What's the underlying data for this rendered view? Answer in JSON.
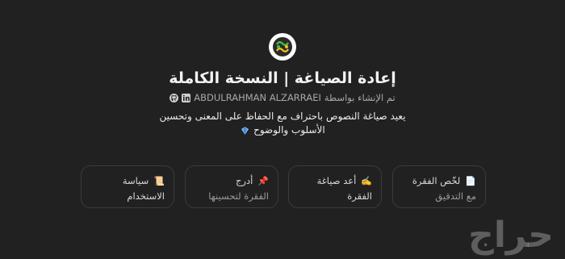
{
  "app": {
    "title": "إعادة الصياغة | النسخة الكاملة",
    "author_prefix": "تم الإنشاء بواسطة",
    "author_name": "ABDULRAHMAN ALZARRAEI",
    "description": "يعيد صياغة النصوص باحتراف مع الحفاظ على المعنى وتحسين الأسلوب والوضوح",
    "logo_icon": "rephrase-logo-icon",
    "accent_color": "#3fb24a"
  },
  "cards": [
    {
      "line1": "لخّص الفقرة",
      "line2": "مع التدقيق",
      "emoji": "📄"
    },
    {
      "line1": "أعد صياغة الفقرة",
      "line2": "",
      "emoji": "✍️"
    },
    {
      "line1": "أدرج",
      "line2": "الفقرة لتحسينها",
      "emoji": "📌"
    },
    {
      "line1": "سياسة الاستخدام",
      "line2": "",
      "emoji": "📜"
    }
  ],
  "watermark": "حراج"
}
